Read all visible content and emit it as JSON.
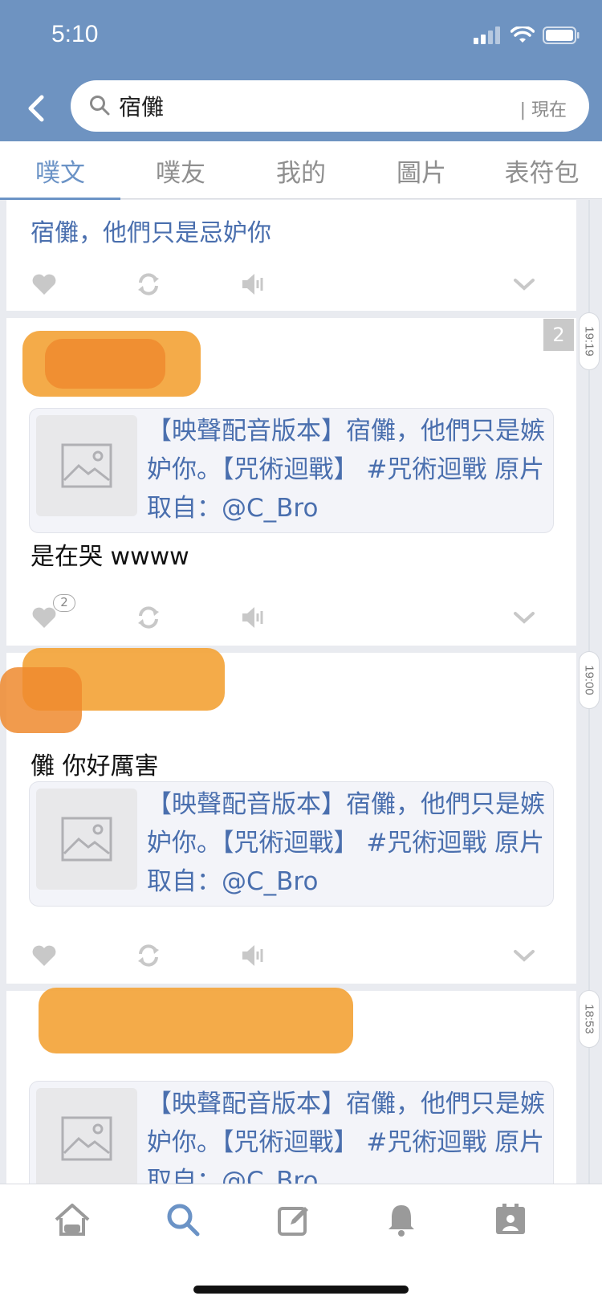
{
  "status_bar": {
    "time": "5:10"
  },
  "search": {
    "query": "宿儺",
    "scope": "| 現在"
  },
  "tabs": [
    {
      "label": "噗文",
      "active": true
    },
    {
      "label": "噗友",
      "active": false
    },
    {
      "label": "我的",
      "active": false
    },
    {
      "label": "圖片",
      "active": false
    },
    {
      "label": "表符包",
      "active": false
    }
  ],
  "posts": [
    {
      "title": "宿儺，他們只是忌妒你"
    },
    {
      "counter": "2",
      "time": "19:19",
      "link_title": "【映聲配音版本】宿儺，他們只是嫉妒你。【咒術迴戰】 #咒術迴戰 原片取自：@C_Bro",
      "text": "是在哭 wwww",
      "like_count": "2"
    },
    {
      "time": "19:00",
      "text": "儺 你好厲害",
      "link_title": "【映聲配音版本】宿儺，他們只是嫉妒你。【咒術迴戰】 #咒術迴戰 原片取自：@C_Bro"
    },
    {
      "time": "18:53",
      "link_title": "【映聲配音版本】宿儺，他們只是嫉妒你。【咒術迴戰】 #咒術迴戰 原片取自：@C_Bro"
    }
  ],
  "colors": {
    "header": "#6e93c1",
    "accent": "#6b93c6",
    "link_text": "#4a6fae",
    "redaction": "#f3a43a"
  },
  "icons": {
    "nav": [
      "home-icon",
      "search-icon",
      "compose-icon",
      "bell-icon",
      "profile-card-icon"
    ],
    "post_actions": [
      "heart-icon",
      "replurk-icon",
      "mute-icon",
      "chevron-down-icon"
    ]
  }
}
